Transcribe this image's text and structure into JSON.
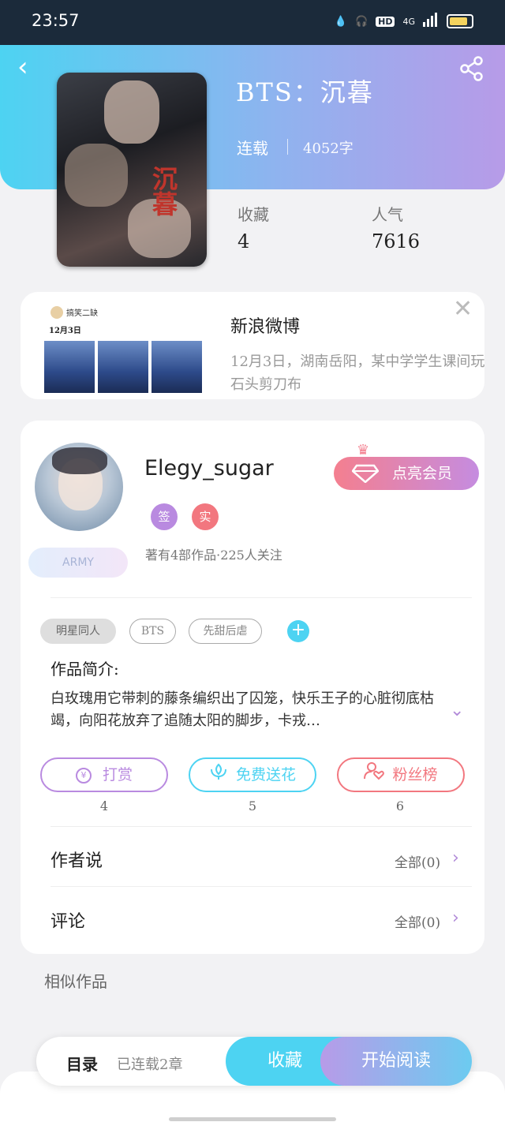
{
  "status_bar": {
    "time": "23:57",
    "network": "4G",
    "hd": "HD"
  },
  "book": {
    "title": "BTS：沉暮",
    "status": "连载",
    "word_count": "4052字",
    "cover_art_text": "沉暮",
    "stats": [
      {
        "label": "收藏",
        "value": "4"
      },
      {
        "label": "人气",
        "value": "7616"
      }
    ]
  },
  "banner": {
    "source_title": "新浪微博",
    "text": "12月3日，湖南岳阳，某中学学生课间玩石头剪刀布",
    "thumb_name": "搞笑二缺",
    "thumb_date": "12月3日"
  },
  "author": {
    "name": "Elegy_sugar",
    "badges": [
      {
        "label": "签",
        "color": "#b98ae0"
      },
      {
        "label": "实",
        "color": "#f2777f"
      }
    ],
    "meta": "著有4部作品·225人关注",
    "fan_badge": "ARMY",
    "vip_button": "点亮会员"
  },
  "tags": [
    "明星同人",
    "BTS",
    "先甜后虐"
  ],
  "intro": {
    "label": "作品简介:",
    "text": "白玫瑰用它带刺的藤条编织出了囚笼，快乐王子的心脏彻底枯竭，向阳花放弃了追随太阳的脚步，卡戎…"
  },
  "actions": [
    {
      "label": "打赏",
      "count": "4",
      "color": "#b98ae0"
    },
    {
      "label": "免费送花",
      "count": "5",
      "color": "#4dd3f2"
    },
    {
      "label": "粉丝榜",
      "count": "6",
      "color": "#f2777f"
    }
  ],
  "rows": [
    {
      "title": "作者说",
      "link": "全部(0)"
    },
    {
      "title": "评论",
      "link": "全部(0)"
    }
  ],
  "similar_label": "相似作品",
  "bottom_bar": {
    "toc_label": "目录",
    "toc_info": "已连载2章",
    "favorite_label": "收藏",
    "read_label": "开始阅读"
  }
}
